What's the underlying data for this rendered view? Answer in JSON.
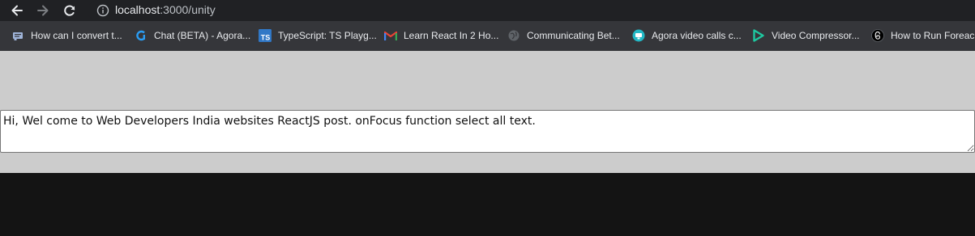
{
  "browser": {
    "address_bar": {
      "host": "localhost",
      "path": ":3000/unity"
    },
    "nav": {
      "back_icon": "arrow-left-icon",
      "forward_icon": "arrow-right-icon",
      "reload_icon": "reload-icon",
      "site_info_icon": "info-circle-icon"
    },
    "bookmarks": [
      {
        "label": "How can I convert t...",
        "icon": "stackexchange-icon",
        "color": "#9fb4d9"
      },
      {
        "label": "Chat (BETA) - Agora...",
        "icon": "agora-icon",
        "color": "#2a9df4"
      },
      {
        "label": "TypeScript: TS Playg...",
        "icon": "typescript-icon",
        "color": "#3178c6"
      },
      {
        "label": "Learn React In 2 Ho...",
        "icon": "gmail-icon",
        "color": "#ea4335"
      },
      {
        "label": "Communicating Bet...",
        "icon": "globe-icon",
        "color": "#5f6368"
      },
      {
        "label": "Agora video calls c...",
        "icon": "agora-video-icon",
        "color": "#23b8c5"
      },
      {
        "label": "Video Compressor...",
        "icon": "play-icon",
        "color": "#1ec8a0"
      },
      {
        "label": "How to Run Foreac...",
        "icon": "threads-icon",
        "color": "#ffffff"
      }
    ]
  },
  "page": {
    "textarea_value": "Hi, Wel come to Web Developers India websites ReactJS post. onFocus function select all text."
  },
  "colors": {
    "toolbar_bg": "#202124",
    "bookmarks_bg": "#35363a",
    "page_bg": "#cccccc",
    "below_page_bg": "#141414"
  }
}
